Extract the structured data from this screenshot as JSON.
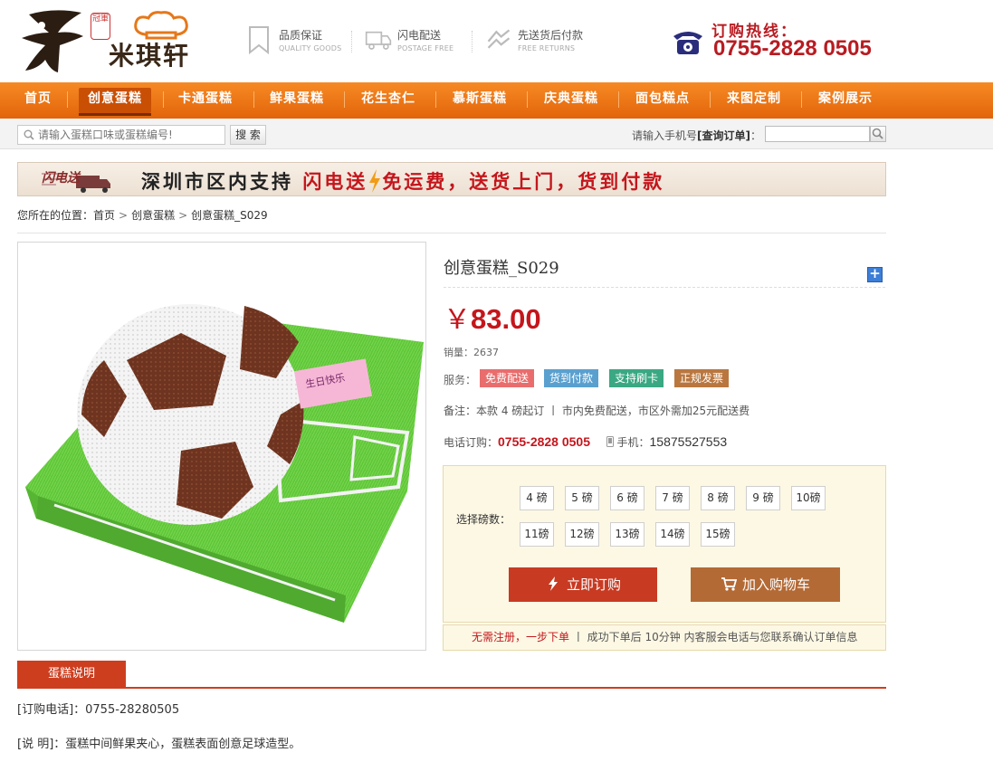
{
  "header": {
    "brand": "米琪轩",
    "seal": "冠軍",
    "features": [
      {
        "title": "品质保证",
        "sub": "QUALITY GOODS",
        "icon": "bookmark-icon"
      },
      {
        "title": "闪电配送",
        "sub": "POSTAGE FREE",
        "icon": "truck-icon"
      },
      {
        "title": "先送货后付款",
        "sub": "FREE RETURNS",
        "icon": "return-icon"
      }
    ],
    "hotline_label": "订购热线：",
    "hotline_number": "0755-2828 0505"
  },
  "nav": {
    "items": [
      "首页",
      "创意蛋糕",
      "卡通蛋糕",
      "鲜果蛋糕",
      "花生杏仁",
      "慕斯蛋糕",
      "庆典蛋糕",
      "面包糕点",
      "来图定制",
      "案例展示"
    ],
    "active_index": 1
  },
  "search": {
    "placeholder": "请输入蛋糕口味或蛋糕编号!",
    "button": "搜 索",
    "order_label": "请输入手机号",
    "order_label_bold": "[查询订单]",
    "order_suffix": "："
  },
  "banner": {
    "badge": "闪电送",
    "text_a": "深圳市区内支持",
    "text_b": "闪电送",
    "text_c": "免运费，送货上门，货到付款"
  },
  "breadcrumb": {
    "label": "您所在的位置：",
    "items": [
      "首页",
      "创意蛋糕",
      "创意蛋糕_S029"
    ],
    "sep": ">"
  },
  "product": {
    "title": "创意蛋糕_S029",
    "plus": "+",
    "currency": "￥",
    "price": "83.00",
    "sold_label": "销量：",
    "sold": "2637",
    "service_label": "服务：",
    "services": [
      {
        "label": "免费配送",
        "color": "#e96d6d"
      },
      {
        "label": "货到付款",
        "color": "#5aa0cf"
      },
      {
        "label": "支持刷卡",
        "color": "#3aa882"
      },
      {
        "label": "正规发票",
        "color": "#b9773f"
      }
    ],
    "note": "备注：本款 4 磅起订 丨 市内免费配送，市区外需加25元配送费",
    "phone_label": "电话订购：",
    "phone": "0755-2828 0505",
    "mobile_label": "手机：",
    "mobile": "15875527553",
    "size_label": "选择磅数：",
    "sizes": [
      "4 磅",
      "5 磅",
      "6 磅",
      "7 磅",
      "8 磅",
      "9 磅",
      "10磅",
      "11磅",
      "12磅",
      "13磅",
      "14磅",
      "15磅"
    ],
    "buy_label": "立即订购",
    "cart_label": "加入购物车",
    "tip_highlight": "无需注册，一步下单",
    "tip_rest": " 丨 成功下单后 10分钟 内客服会电话与您联系确认订单信息"
  },
  "description": {
    "tab": "蛋糕说明",
    "lines": [
      "[订购电话]：0755-28280505",
      "[说 明]：蛋糕中间鲜果夹心，蛋糕表面创意足球造型。"
    ]
  },
  "colors": {
    "accent": "#f07a18",
    "price": "#c4161c",
    "buy": "#c83a22",
    "cart": "#b46a35"
  }
}
